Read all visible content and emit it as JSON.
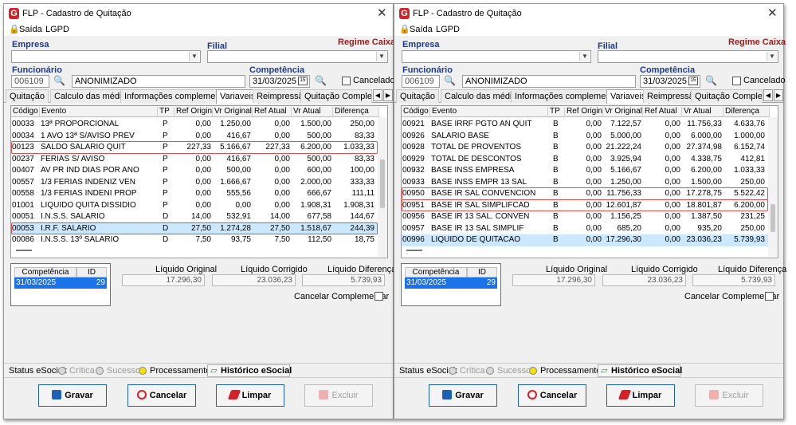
{
  "windows": [
    {
      "title": "FLP - Cadastro de Quitação",
      "menu": [
        "Saída",
        "LGPD"
      ],
      "empresa_label": "Empresa",
      "filial_label": "Filial",
      "regime_label": "Regime Caixa",
      "funcionario_label": "Funcionário",
      "funcionario_id": "006109",
      "funcionario_nome": "ANONIMIZADO",
      "competencia_label": "Competência",
      "competencia_value": "31/03/2025",
      "cancelado_label": "Cancelado",
      "tabs": [
        "Quitação",
        "Calculo das médias",
        "Informações complementares",
        "Variaveis",
        "Reimpressão",
        "Quitação Complementa"
      ],
      "grid_headers": [
        "Código",
        "Evento",
        "TP",
        "Ref Original",
        "Vr Original",
        "Ref Atual",
        "Vr Atual",
        "Diferença"
      ],
      "rows": [
        [
          "00033",
          "13ª PROPORCIONAL",
          "P",
          "0,00",
          "1.250,00",
          "0,00",
          "1.500,00",
          "250,00"
        ],
        [
          "00034",
          "1 AVO 13ª S/AVISO PREV",
          "P",
          "0,00",
          "416,67",
          "0,00",
          "500,00",
          "83,33"
        ],
        [
          "00123",
          "SALDO SALARIO QUIT",
          "P",
          "227,33",
          "5.166,67",
          "227,33",
          "6.200,00",
          "1.033,33"
        ],
        [
          "00237",
          "FERIAS S/ AVISO",
          "P",
          "0,00",
          "416,67",
          "0,00",
          "500,00",
          "83,33"
        ],
        [
          "00407",
          "AV PR IND DIAS POR ANO",
          "P",
          "0,00",
          "500,00",
          "0,00",
          "600,00",
          "100,00"
        ],
        [
          "00557",
          "1/3 FERIAS INDENIZ VEN",
          "P",
          "0,00",
          "1.666,67",
          "0,00",
          "2.000,00",
          "333,33"
        ],
        [
          "00558",
          "1/3 FERIAS INDENI PROP",
          "P",
          "0,00",
          "555,56",
          "0,00",
          "666,67",
          "111,11"
        ],
        [
          "01001",
          "LIQUIDO QUITA DISSIDIO",
          "P",
          "0,00",
          "0,00",
          "0,00",
          "1.908,31",
          "1.908,31"
        ],
        [
          "00051",
          "I.N.S.S. SALARIO",
          "D",
          "14,00",
          "532,91",
          "14,00",
          "677,58",
          "144,67"
        ],
        [
          "00053",
          "I.R.F. SALARIO",
          "D",
          "27,50",
          "1.274,28",
          "27,50",
          "1.518,67",
          "244,39"
        ],
        [
          "00086",
          "I.N.S.S. 13º SALARIO",
          "D",
          "7,50",
          "93,75",
          "7,50",
          "112,50",
          "18,75"
        ]
      ],
      "selected_row": 9,
      "highlighted_rows": [
        2,
        9
      ],
      "scroll_thumb": {
        "start": 0.3,
        "size": 0.35
      },
      "comp_grid": {
        "headers": [
          "Competência",
          "ID"
        ],
        "row": [
          "31/03/2025",
          "29"
        ]
      },
      "liquido_original_label": "Líquido Original",
      "liquido_original": "17.296,30",
      "liquido_corrigido_label": "Líquido Corrigido",
      "liquido_corrigido": "23.036,23",
      "liquido_diferenca_label": "Líquido Diferença",
      "liquido_diferenca": "5.739,93",
      "cancelar_complementar_label": "Cancelar Complementar",
      "status_label": "Status eSocial:",
      "status_items": [
        "Crítica",
        "Sucesso",
        "Processamento"
      ],
      "historico_label": "Histórico eSocial",
      "buttons": [
        "Gravar",
        "Cancelar",
        "Limpar",
        "Excluir"
      ]
    },
    {
      "title": "FLP - Cadastro de Quitação",
      "menu": [
        "Saída",
        "LGPD"
      ],
      "empresa_label": "Empresa",
      "filial_label": "Filial",
      "regime_label": "Regime Caixa",
      "funcionario_label": "Funcionário",
      "funcionario_id": "006109",
      "funcionario_nome": "ANONIMIZADO",
      "competencia_label": "Competência",
      "competencia_value": "31/03/2025",
      "cancelado_label": "Cancelado",
      "tabs": [
        "Quitação",
        "Calculo das médias",
        "Informações complementares",
        "Variaveis",
        "Reimpressão",
        "Quitação Complementa"
      ],
      "grid_headers": [
        "Código",
        "Evento",
        "TP",
        "Ref Original",
        "Vr Original",
        "Ref Atual",
        "Vr Atual",
        "Diferença"
      ],
      "rows": [
        [
          "00921",
          "BASE IRRF PGTO AN QUIT",
          "B",
          "0,00",
          "7.122,57",
          "0,00",
          "11.756,33",
          "4.633,76"
        ],
        [
          "00926",
          "SALARIO BASE",
          "B",
          "0,00",
          "5.000,00",
          "0,00",
          "6.000,00",
          "1.000,00"
        ],
        [
          "00928",
          "TOTAL DE PROVENTOS",
          "B",
          "0,00",
          "21.222,24",
          "0,00",
          "27.374,98",
          "6.152,74"
        ],
        [
          "00929",
          "TOTAL DE DESCONTOS",
          "B",
          "0,00",
          "3.925,94",
          "0,00",
          "4.338,75",
          "412,81"
        ],
        [
          "00932",
          "BASE INSS EMPRESA",
          "B",
          "0,00",
          "5.166,67",
          "0,00",
          "6.200,00",
          "1.033,33"
        ],
        [
          "00933",
          "BASE INSS EMPR 13 SAL",
          "B",
          "0,00",
          "1.250,00",
          "0,00",
          "1.500,00",
          "250,00"
        ],
        [
          "00950",
          "BASE IR SAL CONVENCION",
          "B",
          "0,00",
          "11.756,33",
          "0,00",
          "17.278,75",
          "5.522,42"
        ],
        [
          "00951",
          "BASE IR SAL SIMPLIFCAD",
          "B",
          "0,00",
          "12.601,87",
          "0,00",
          "18.801,87",
          "6.200,00"
        ],
        [
          "00956",
          "BASE IR 13 SAL. CONVEN",
          "B",
          "0,00",
          "1.156,25",
          "0,00",
          "1.387,50",
          "231,25"
        ],
        [
          "00957",
          "BASE IR 13 SAL SIMPLIF",
          "B",
          "0,00",
          "685,20",
          "0,00",
          "935,20",
          "250,00"
        ],
        [
          "00996",
          "LIQUIDO DE QUITACAO",
          "B",
          "0,00",
          "17.296,30",
          "0,00",
          "23.036,23",
          "5.739,93"
        ]
      ],
      "selected_row": 10,
      "highlighted_rows": [
        6,
        7
      ],
      "scroll_thumb": {
        "start": 0.62,
        "size": 0.2
      },
      "comp_grid": {
        "headers": [
          "Competência",
          "ID"
        ],
        "row": [
          "31/03/2025",
          "29"
        ]
      },
      "liquido_original_label": "Líquido Original",
      "liquido_original": "17.296,30",
      "liquido_corrigido_label": "Líquido Corrigido",
      "liquido_corrigido": "23.036,23",
      "liquido_diferenca_label": "Líquido Diferença",
      "liquido_diferenca": "5.739,93",
      "cancelar_complementar_label": "Cancelar Complementar",
      "status_label": "Status eSocial:",
      "status_items": [
        "Crítica",
        "Sucesso",
        "Processamento"
      ],
      "historico_label": "Histórico eSocial",
      "buttons": [
        "Gravar",
        "Cancelar",
        "Limpar",
        "Excluir"
      ]
    }
  ],
  "colors": {
    "brand": "#d42027",
    "highlight": "#e05050",
    "selection": "#1a73e8",
    "row_selected": "#cce8ff"
  }
}
